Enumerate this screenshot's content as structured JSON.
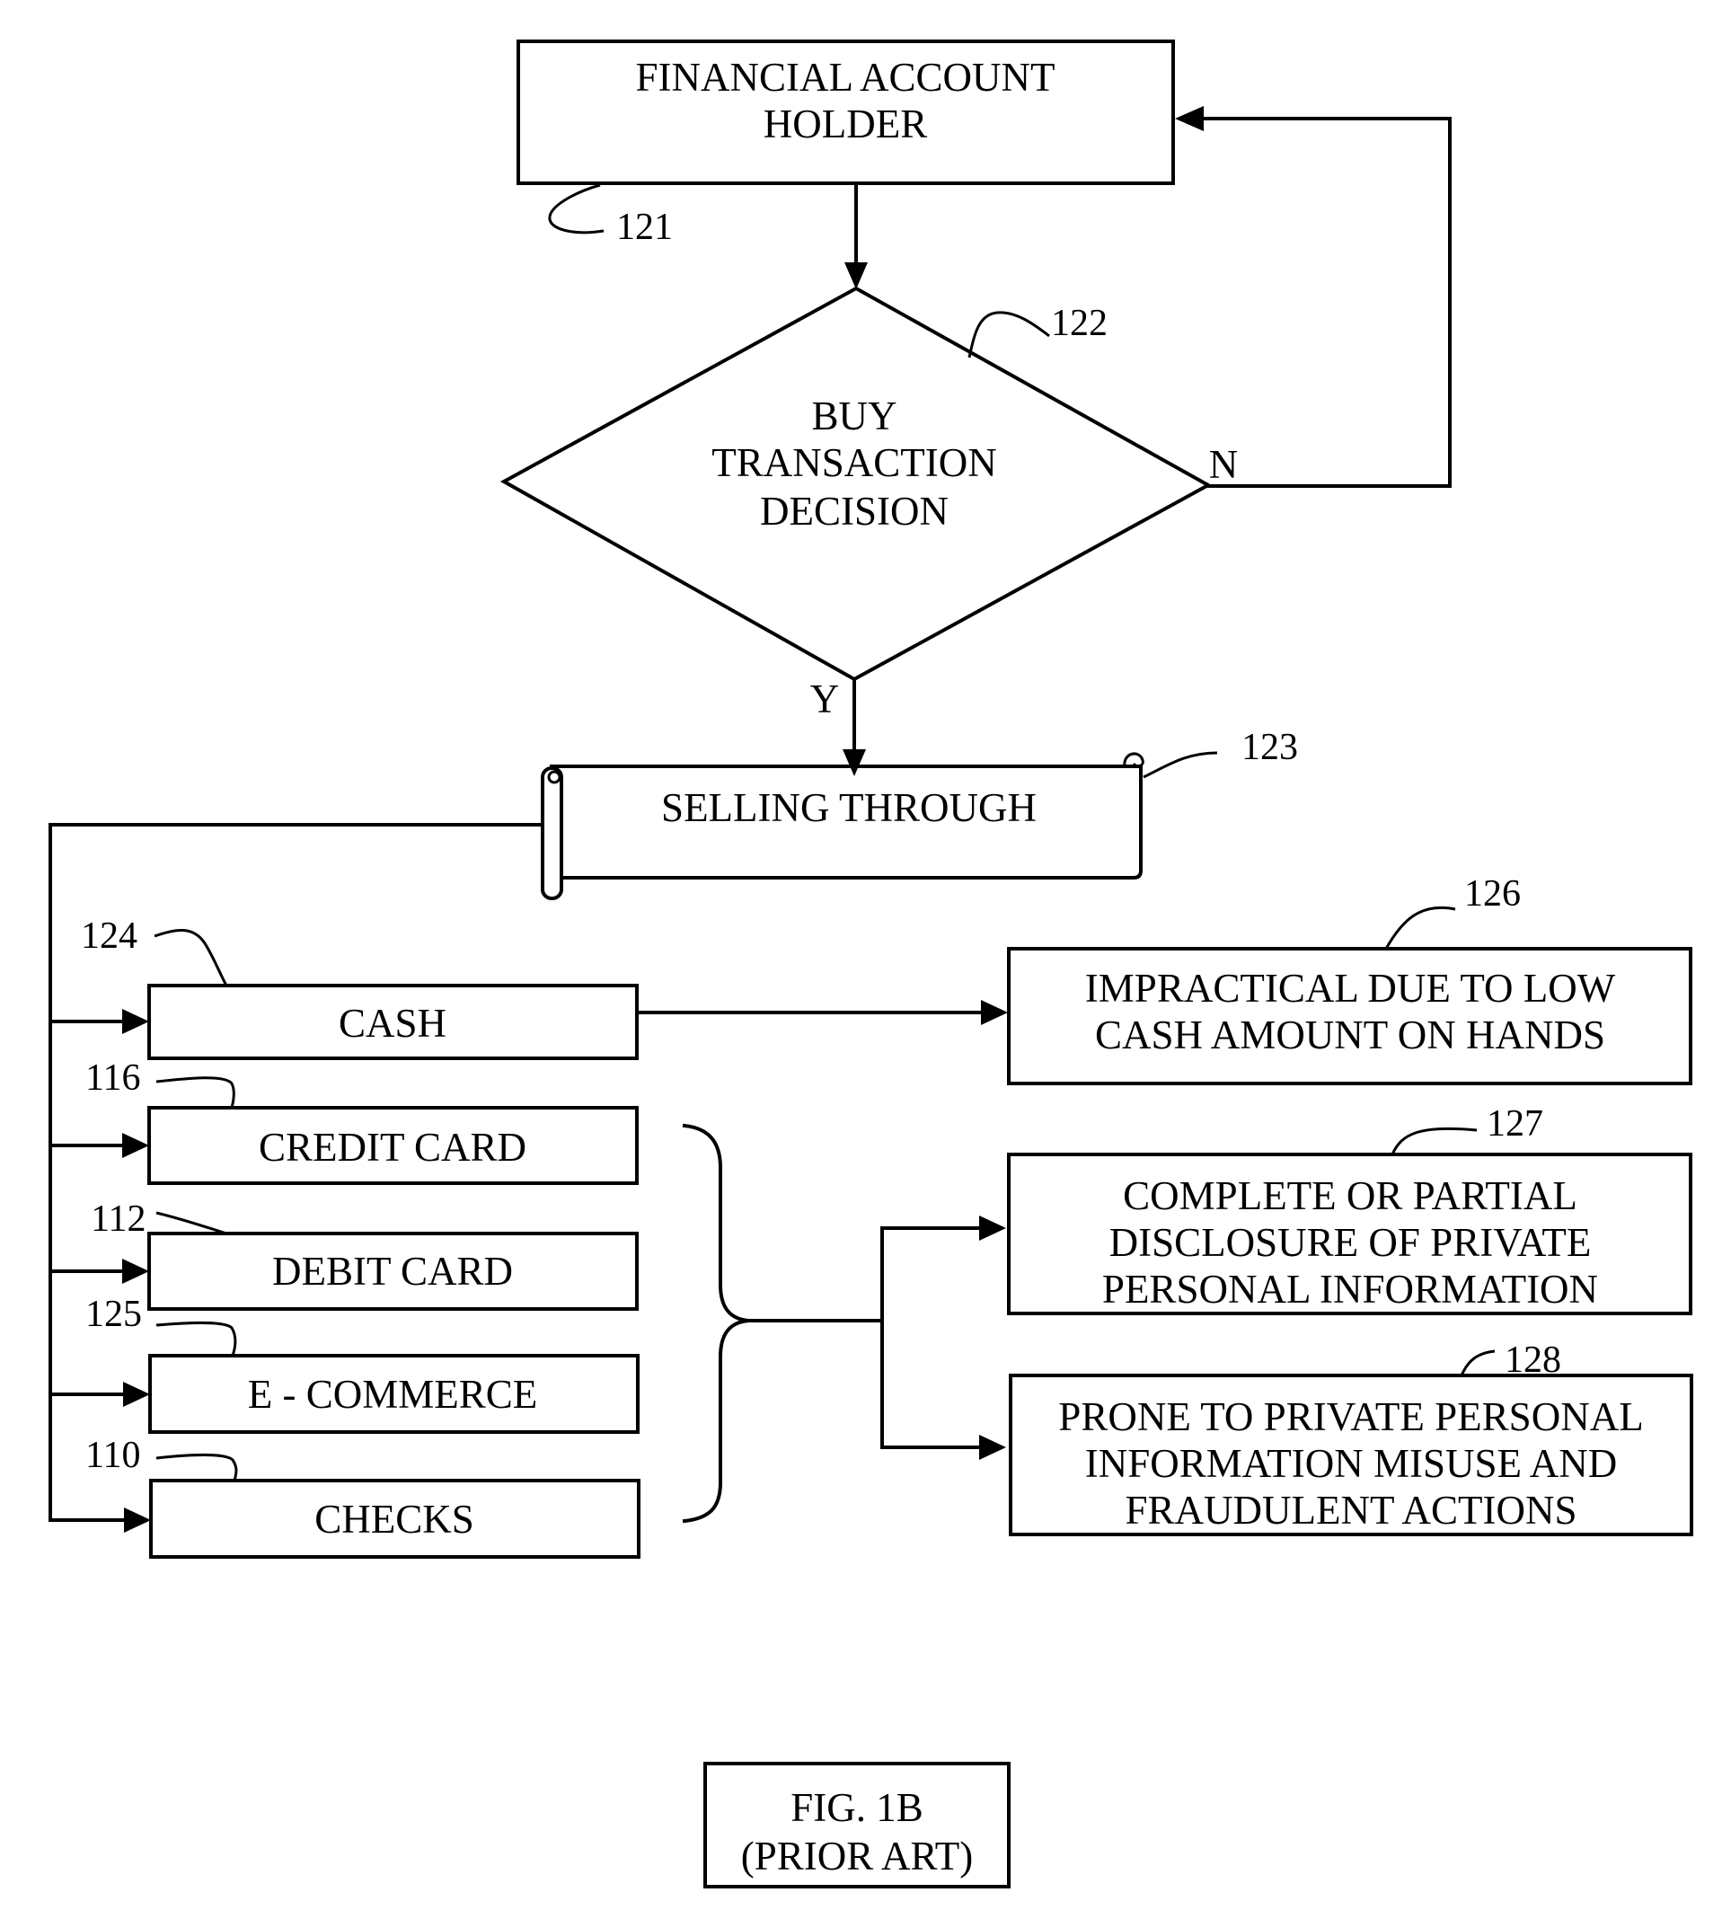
{
  "figure": {
    "caption_line1": "FIG. 1B",
    "caption_line2": "(PRIOR ART)"
  },
  "nodes": {
    "account_holder": {
      "ref": "121",
      "lines": [
        "FINANCIAL ACCOUNT",
        "HOLDER"
      ]
    },
    "decision": {
      "ref": "122",
      "lines": [
        "BUY",
        "TRANSACTION",
        "DECISION"
      ],
      "no_label": "N",
      "yes_label": "Y"
    },
    "selling_through": {
      "ref": "123",
      "label": "SELLING THROUGH"
    },
    "methods": [
      {
        "ref": "124",
        "label": "CASH"
      },
      {
        "ref": "116",
        "label": "CREDIT CARD"
      },
      {
        "ref": "112",
        "label": "DEBIT CARD"
      },
      {
        "ref": "125",
        "label": "E - COMMERCE"
      },
      {
        "ref": "110",
        "label": "CHECKS"
      }
    ],
    "outcomes": [
      {
        "ref": "126",
        "lines": [
          "IMPRACTICAL DUE TO LOW",
          "CASH AMOUNT ON HANDS"
        ]
      },
      {
        "ref": "127",
        "lines": [
          "COMPLETE OR PARTIAL",
          "DISCLOSURE OF PRIVATE",
          "PERSONAL INFORMATION"
        ]
      },
      {
        "ref": "128",
        "lines": [
          "PRONE TO PRIVATE PERSONAL",
          "INFORMATION MISUSE AND",
          "FRAUDULENT ACTIONS"
        ]
      }
    ]
  }
}
